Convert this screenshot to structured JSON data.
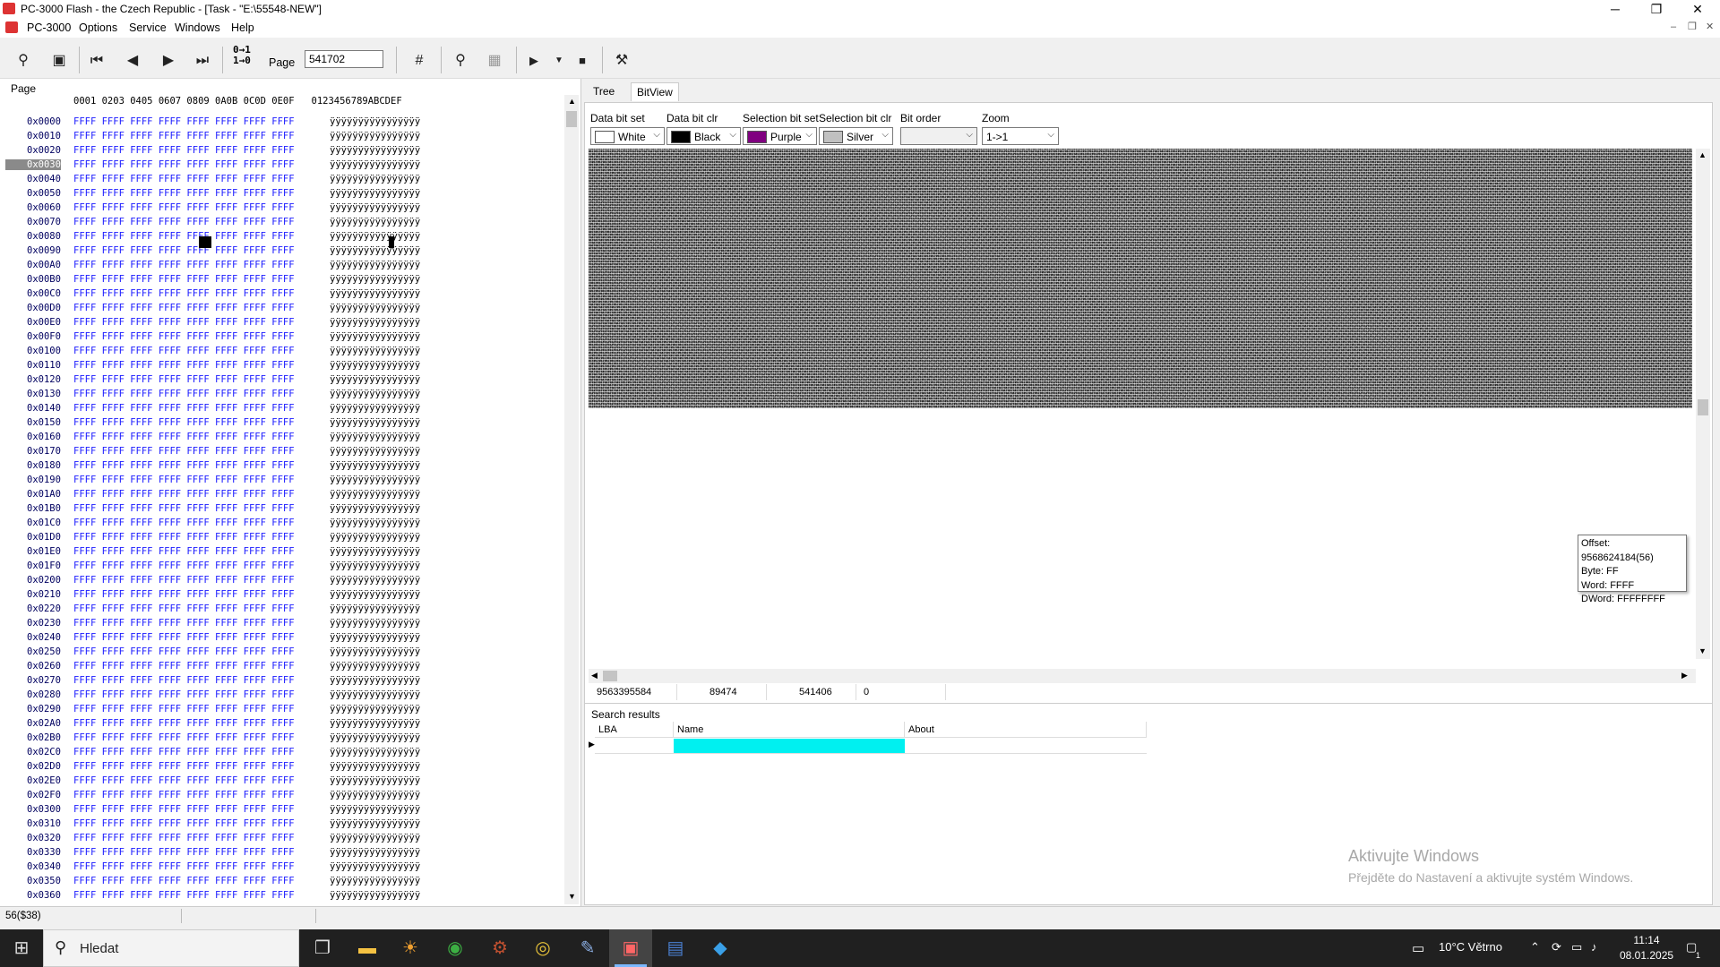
{
  "window": {
    "title": "PC-3000 Flash - the Czech Republic - [Task - \"E:\\55548-NEW\"]",
    "minimize": "─",
    "restore": "❐",
    "close": "✕"
  },
  "menu": {
    "app": "PC-3000",
    "items": [
      "Options",
      "Service",
      "Windows",
      "Help"
    ]
  },
  "toolbar": {
    "page_label": "Page",
    "page_value": "541702",
    "bits_label_top": "0→1",
    "bits_label_bottom": "1→0"
  },
  "hex": {
    "caption": "Page",
    "header": "0001 0203 0405 0607 0809 0A0B 0C0D 0E0F   0123456789ABCDEF",
    "word_value": "FFFF",
    "ascii_value": "ÿÿÿÿÿÿÿÿÿÿÿÿÿÿÿÿ",
    "selected_offset": "0x0030",
    "offsets": [
      "0x0000",
      "0x0010",
      "0x0020",
      "0x0030",
      "0x0040",
      "0x0050",
      "0x0060",
      "0x0070",
      "0x0080",
      "0x0090",
      "0x00A0",
      "0x00B0",
      "0x00C0",
      "0x00D0",
      "0x00E0",
      "0x00F0",
      "0x0100",
      "0x0110",
      "0x0120",
      "0x0130",
      "0x0140",
      "0x0150",
      "0x0160",
      "0x0170",
      "0x0180",
      "0x0190",
      "0x01A0",
      "0x01B0",
      "0x01C0",
      "0x01D0",
      "0x01E0",
      "0x01F0",
      "0x0200",
      "0x0210",
      "0x0220",
      "0x0230",
      "0x0240",
      "0x0250",
      "0x0260",
      "0x0270",
      "0x0280",
      "0x0290",
      "0x02A0",
      "0x02B0",
      "0x02C0",
      "0x02D0",
      "0x02E0",
      "0x02F0",
      "0x0300",
      "0x0310",
      "0x0320",
      "0x0330",
      "0x0340",
      "0x0350",
      "0x0360"
    ]
  },
  "tabs": [
    {
      "label": "Tree"
    },
    {
      "label": "BitView",
      "active": true
    }
  ],
  "bitview": {
    "controls": [
      {
        "label": "Data bit set",
        "value": "White",
        "swatch": "#ffffff"
      },
      {
        "label": "Data bit clr",
        "value": "Black",
        "swatch": "#000000"
      },
      {
        "label": "Selection bit set",
        "value": "Purple",
        "swatch": "#800080"
      },
      {
        "label": "Selection bit clr",
        "value": "Silver",
        "swatch": "#c0c0c0"
      },
      {
        "label": "Bit order",
        "value": "",
        "swatch": ""
      },
      {
        "label": "Zoom",
        "value": "1->1",
        "swatch": ""
      }
    ],
    "tooltip": {
      "offset": "Offset: 9568624184(56)",
      "byte": "Byte: FF",
      "word": "Word: FFFF",
      "dword": "DWord: FFFFFFFF"
    },
    "status": [
      "9563395584",
      "89474",
      "541406",
      "0"
    ]
  },
  "search_results": {
    "caption": "Search results",
    "columns": [
      "LBA",
      "Name",
      "About"
    ],
    "highlight_color": "#00f0f0"
  },
  "watermark": {
    "line1": "Aktivujte Windows",
    "line2": "Přejděte do Nastavení a aktivujte systém Windows."
  },
  "statusbar": {
    "text": "56($38)"
  },
  "taskbar": {
    "search_placeholder": "Hledat",
    "weather": "10°C  Větrno",
    "time": "11:14",
    "date": "08.01.2025",
    "notifications": "1"
  },
  "colors": {
    "hex_blue": "#1a1aff",
    "selection_purple": "#800080",
    "accent_cyan": "#00f0f0"
  }
}
